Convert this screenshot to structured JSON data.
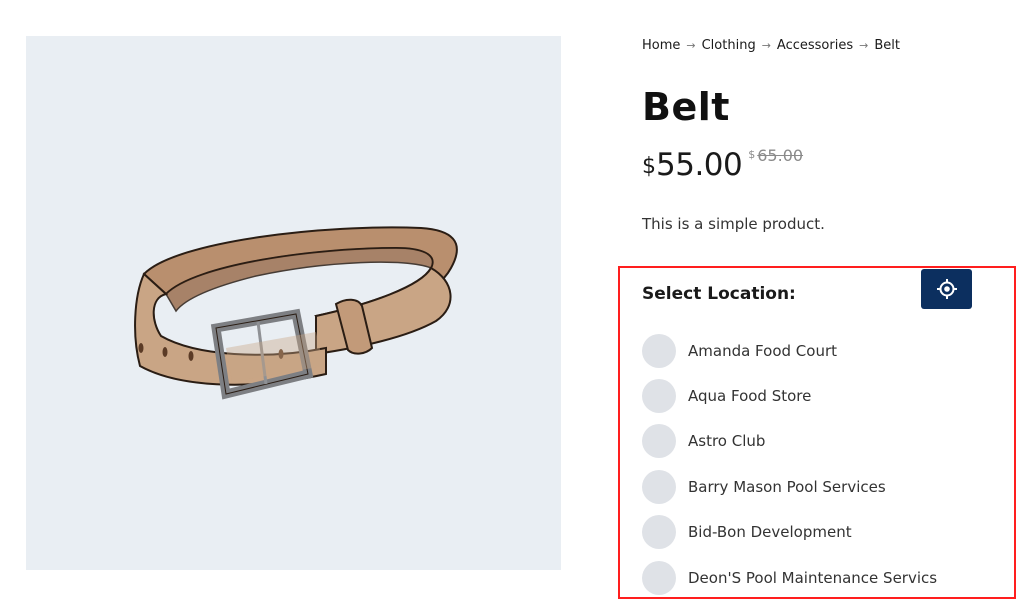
{
  "breadcrumb": {
    "items": [
      "Home",
      "Clothing",
      "Accessories",
      "Belt"
    ],
    "separator": "→"
  },
  "product": {
    "title": "Belt",
    "price_currency": "$",
    "price": "55.00",
    "old_price_currency": "$",
    "old_price": "65.00",
    "description": "This is a simple product.",
    "image_icon": "belt-image"
  },
  "location": {
    "heading": "Select Location:",
    "locate_icon": "crosshair-icon",
    "options": [
      "Amanda Food Court",
      "Aqua Food Store",
      "Astro Club",
      "Barry Mason Pool Services",
      "Bid-Bon Development",
      "Deon'S Pool Maintenance Servics"
    ]
  },
  "colors": {
    "image_background": "#e9eef3",
    "locate_button": "#0c2f5f",
    "highlight_border": "#ff1e1e",
    "radio_fill": "#dfe2e7"
  }
}
